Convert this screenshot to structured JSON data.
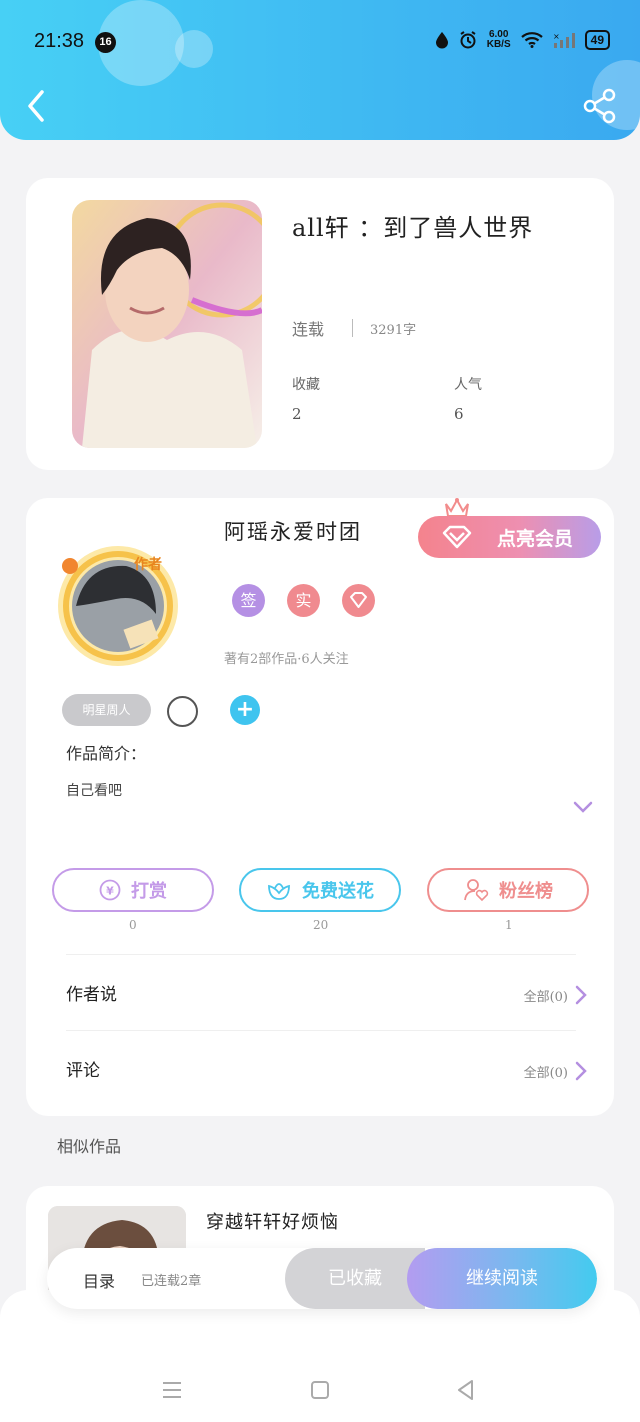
{
  "status_bar": {
    "time": "21:38",
    "notification_count": "16",
    "net_speed_value": "6.00",
    "net_speed_unit": "KB/S",
    "battery": "49"
  },
  "book": {
    "title": "all轩 ：到了兽人世界",
    "status": "连载",
    "word_count": "3291字",
    "favorites_label": "收藏",
    "favorites_value": "2",
    "popularity_label": "人气",
    "popularity_value": "6"
  },
  "author": {
    "name": "阿瑶永爱时团",
    "avatar_tag": "作者",
    "vip_button": "点亮会员",
    "badges": [
      {
        "label": "签",
        "color": "#b590e4"
      },
      {
        "label": "实",
        "color": "#f08a8f"
      }
    ],
    "meta": "著有2部作品·6人关注",
    "fan_tag": "明星周人",
    "intro_label": "作品简介：",
    "intro_text": "自己看吧"
  },
  "actions": [
    {
      "label": "打赏",
      "count": "0",
      "color": "#c49be8"
    },
    {
      "label": "免费送花",
      "count": "20",
      "color": "#49c6ec"
    },
    {
      "label": "粉丝榜",
      "count": "1",
      "color": "#ef8e8e"
    }
  ],
  "rows": [
    {
      "label": "作者说",
      "right": "全部(0)"
    },
    {
      "label": "评论",
      "right": "全部(0)"
    }
  ],
  "similar": {
    "section_title": "相似作品",
    "items": [
      {
        "title": "穿越轩轩好烦恼"
      }
    ]
  },
  "bottom_bar": {
    "toc_label": "目录",
    "serial_status": "已连载2章",
    "favorited_label": "已收藏",
    "continue_label": "继续阅读"
  },
  "colors": {
    "accent_blue": "#3fb8f2",
    "accent_purple": "#b39cf0",
    "chevron": "#b48fe0"
  }
}
